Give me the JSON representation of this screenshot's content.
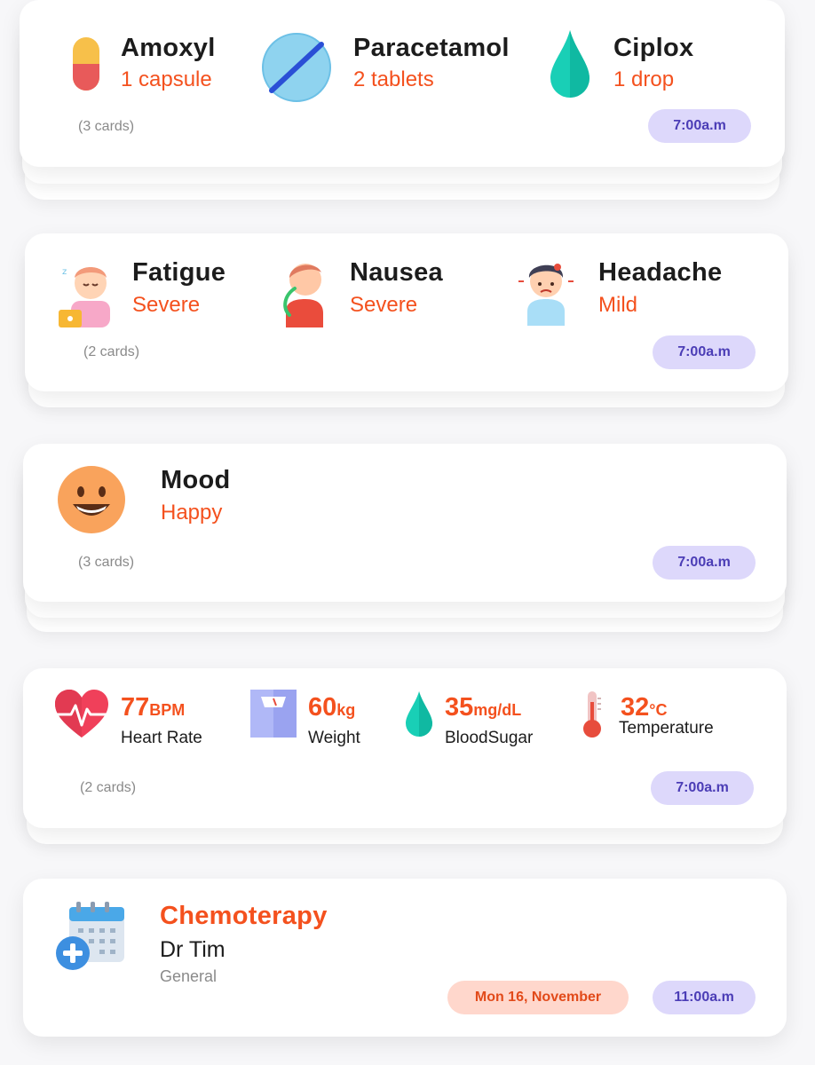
{
  "medications": {
    "items": [
      {
        "name": "Amoxyl",
        "dose": "1 capsule",
        "icon": "capsule-icon"
      },
      {
        "name": "Paracetamol",
        "dose": "2 tablets",
        "icon": "tablet-icon"
      },
      {
        "name": "Ciplox",
        "dose": "1 drop",
        "icon": "drop-icon"
      }
    ],
    "cards_label": "(3 cards)",
    "time": "7:00a.m"
  },
  "symptoms": {
    "items": [
      {
        "name": "Fatigue",
        "severity": "Severe",
        "icon": "fatigue-icon"
      },
      {
        "name": "Nausea",
        "severity": "Severe",
        "icon": "nausea-icon"
      },
      {
        "name": "Headache",
        "severity": "Mild",
        "icon": "headache-icon"
      }
    ],
    "cards_label": "(2 cards)",
    "time": "7:00a.m"
  },
  "mood": {
    "title": "Mood",
    "value": "Happy",
    "icon": "happy-face-icon",
    "cards_label": "(3 cards)",
    "time": "7:00a.m"
  },
  "vitals": {
    "items": [
      {
        "value": "77",
        "unit": "BPM",
        "label": "Heart Rate",
        "icon": "heart-rate-icon"
      },
      {
        "value": "60",
        "unit": "kg",
        "label": "Weight",
        "icon": "weight-scale-icon"
      },
      {
        "value": "35",
        "unit": "mg/dL",
        "label": "BloodSugar",
        "icon": "blood-drop-icon"
      },
      {
        "value": "32",
        "unit": "°C",
        "label": "Temperature",
        "icon": "thermometer-icon"
      }
    ],
    "cards_label": "(2 cards)",
    "time": "7:00a.m"
  },
  "appointment": {
    "title": "Chemoterapy",
    "doctor": "Dr Tim",
    "department": "General",
    "date": "Mon 16, November",
    "time": "11:00a.m",
    "icon": "calendar-plus-icon"
  },
  "colors": {
    "accent": "#f4511e",
    "time_pill_bg": "#ddd8fb",
    "time_pill_text": "#4b3db6",
    "date_pill_bg": "#ffd7cc"
  }
}
